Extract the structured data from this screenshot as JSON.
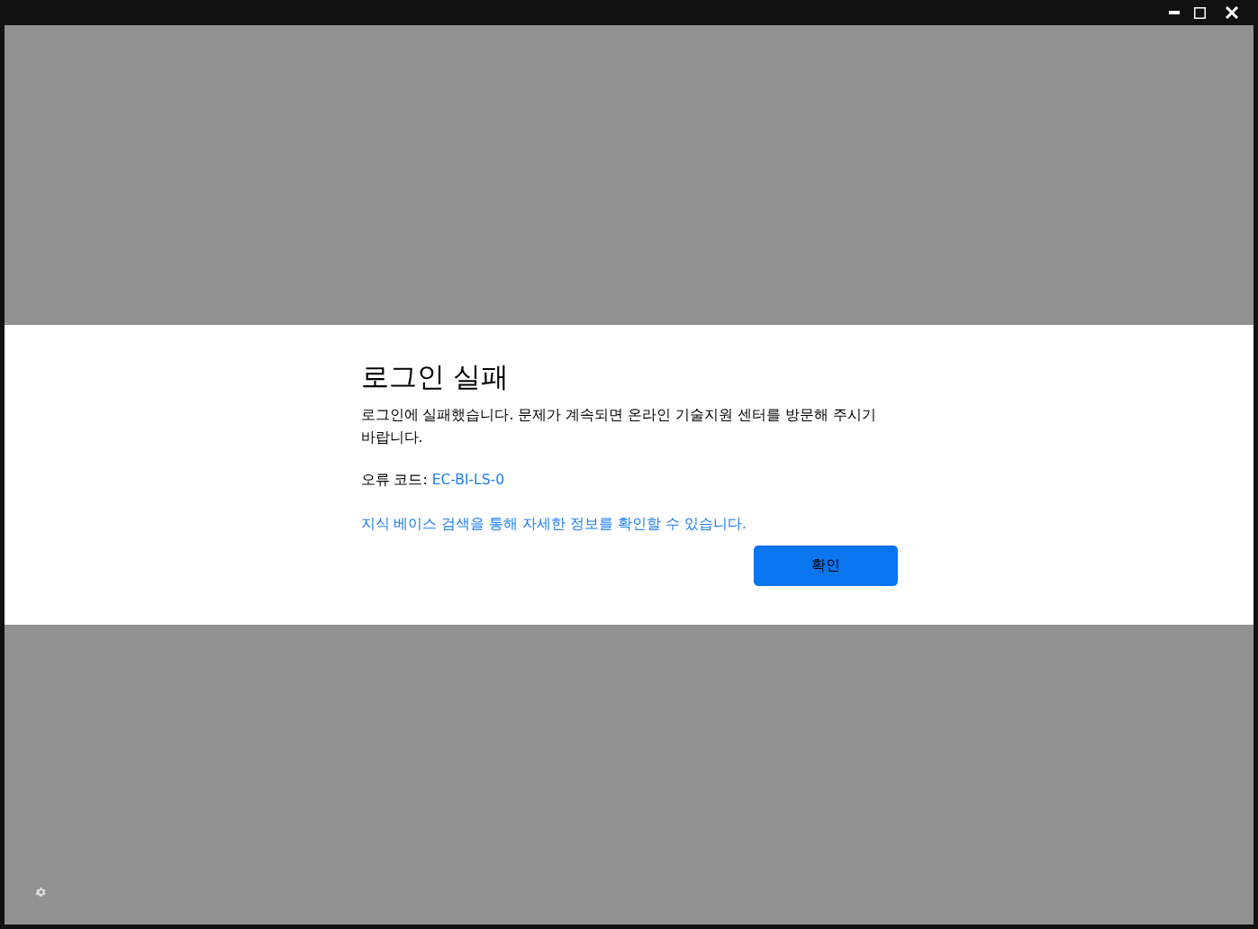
{
  "window": {
    "buttons": [
      {
        "kind": "minimize"
      },
      {
        "kind": "maximize"
      },
      {
        "kind": "close"
      }
    ]
  },
  "dialog": {
    "title": "로그인 실패",
    "message": "로그인에 실패했습니다. 문제가 계속되면 온라인 기술지원 센터를 방문해 주시기 바랍니다.",
    "error_label": "오류 코드:",
    "error_code": "EC-BI-LS-0",
    "kb_link": "지식 베이스 검색을 통해 자세한 정보를 확인할 수 있습니다.",
    "confirm_button": "확인"
  }
}
